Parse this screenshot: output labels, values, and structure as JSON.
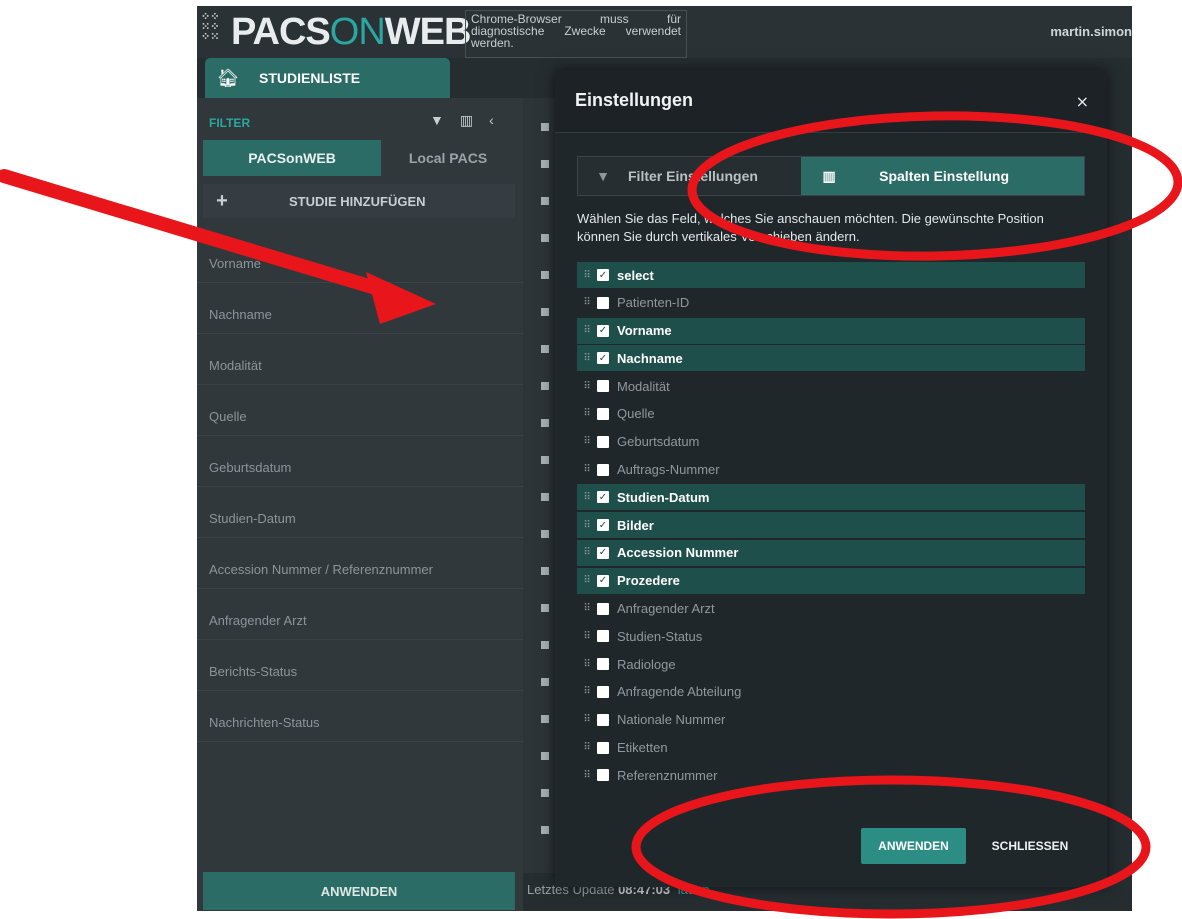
{
  "header": {
    "logo_part1": "PACS",
    "logo_part2": "ON",
    "logo_part3": "WEB",
    "notice": "Chrome-Browser muss für diagnostische Zwecke verwendet werden.",
    "user": "martin.simon"
  },
  "main_tab": {
    "label": "STUDIENLISTE",
    "icon": "home-icon"
  },
  "sidebar": {
    "filter_label": "FILTER",
    "source_tabs": [
      {
        "label": "PACSonWEB",
        "active": true
      },
      {
        "label": "Local PACS",
        "active": false
      }
    ],
    "add_study_label": "STUDIE HINZUFÜGEN",
    "fields": [
      "Vorname",
      "Nachname",
      "Modalität",
      "Quelle",
      "Geburtsdatum",
      "Studien-Datum",
      "Accession Nummer / Referenznummer",
      "Anfragender Arzt",
      "Berichts-Status",
      "Nachrichten-Status"
    ],
    "apply_label": "ANWENDEN"
  },
  "footer": {
    "update_text": "Letztes Update",
    "update_time": "08:47:03",
    "link_text": "laden"
  },
  "modal": {
    "title": "Einstellungen",
    "close": "×",
    "tabs": [
      {
        "label": "Filter Einstellungen",
        "icon": "filter-icon",
        "active": false
      },
      {
        "label": "Spalten Einstellung",
        "icon": "columns-icon",
        "active": true
      }
    ],
    "description": "Wählen Sie das Feld, welches Sie anschauen möchten. Die gewünschte Position können Sie durch vertikales Verschieben ändern.",
    "columns": [
      {
        "label": "select",
        "checked": true
      },
      {
        "label": "Patienten-ID",
        "checked": false
      },
      {
        "label": "Vorname",
        "checked": true
      },
      {
        "label": "Nachname",
        "checked": true
      },
      {
        "label": "Modalität",
        "checked": false
      },
      {
        "label": "Quelle",
        "checked": false
      },
      {
        "label": "Geburtsdatum",
        "checked": false
      },
      {
        "label": "Auftrags-Nummer",
        "checked": false
      },
      {
        "label": "Studien-Datum",
        "checked": true
      },
      {
        "label": "Bilder",
        "checked": true
      },
      {
        "label": "Accession Nummer",
        "checked": true
      },
      {
        "label": "Prozedere",
        "checked": true
      },
      {
        "label": "Anfragender Arzt",
        "checked": false
      },
      {
        "label": "Studien-Status",
        "checked": false
      },
      {
        "label": "Radiologe",
        "checked": false
      },
      {
        "label": "Anfragende Abteilung",
        "checked": false
      },
      {
        "label": "Nationale Nummer",
        "checked": false
      },
      {
        "label": "Etiketten",
        "checked": false
      },
      {
        "label": "Referenznummer",
        "checked": false
      }
    ],
    "apply_label": "ANWENDEN",
    "close_label": "SCHLIESSEN"
  },
  "colors": {
    "accent": "#2b6d66",
    "accent_bright": "#2aa7a0",
    "annotation_red": "#e8161b"
  }
}
